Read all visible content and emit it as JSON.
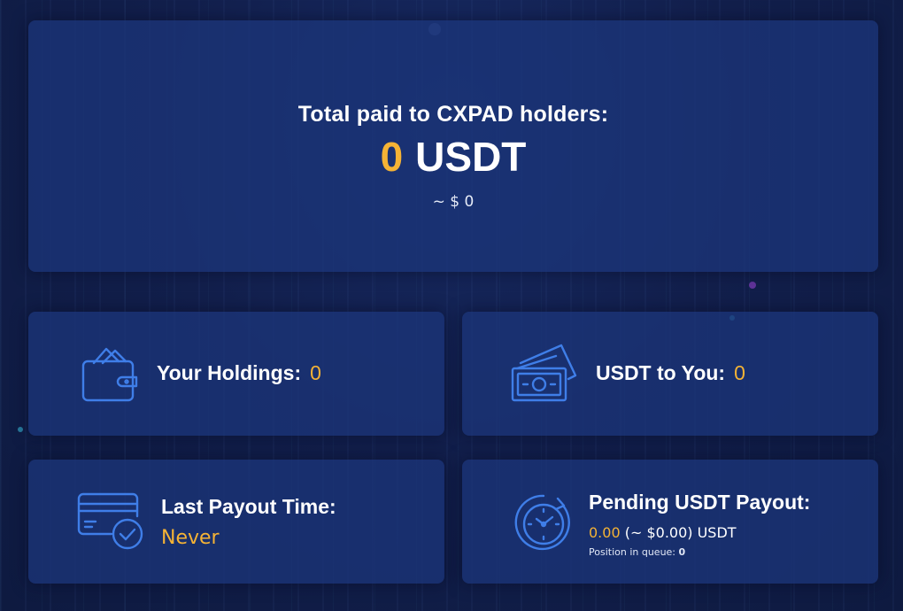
{
  "hero": {
    "title": "Total paid to CXPAD holders:",
    "amount": "0",
    "unit": "USDT",
    "usd_estimate": "~ $ 0"
  },
  "holdings": {
    "label": "Your Holdings:",
    "value": "0",
    "icon": "wallet-icon"
  },
  "usdt_to_you": {
    "label": "USDT to You:",
    "value": "0",
    "icon": "banknotes-icon"
  },
  "last_payout": {
    "label": "Last Payout Time:",
    "value": "Never",
    "icon": "card-check-icon"
  },
  "pending": {
    "label": "Pending USDT Payout:",
    "amount": "0.00",
    "usd_estimate": "(~ $0.00)",
    "unit": "USDT",
    "queue_label": "Position in queue:",
    "queue_value": "0",
    "icon": "clock-refresh-icon"
  },
  "colors": {
    "accent": "#f5b335",
    "icon_blue": "#3f7ee8",
    "card_bg": "#1b3478",
    "page_bg": "#101c45"
  }
}
